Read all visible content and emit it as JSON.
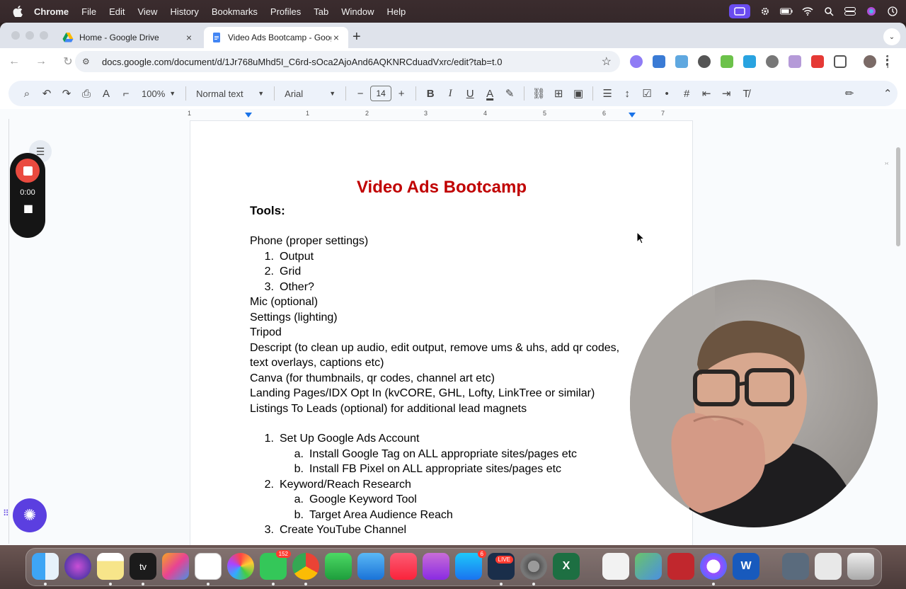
{
  "menubar": {
    "app": "Chrome",
    "items": [
      "File",
      "Edit",
      "View",
      "History",
      "Bookmarks",
      "Profiles",
      "Tab",
      "Window",
      "Help"
    ]
  },
  "tabs": [
    {
      "title": "Home - Google Drive",
      "icon": "google-drive-icon"
    },
    {
      "title": "Video Ads Bootcamp - Googl",
      "icon": "google-docs-icon"
    }
  ],
  "address_bar": {
    "url": "docs.google.com/document/d/1Jr768uMhd5I_C6rd-sOca2AjoAnd6AQKNRCduadVxrc/edit?tab=t.0"
  },
  "toolbar": {
    "zoom": "100%",
    "style": "Normal text",
    "font": "Arial",
    "font_size": "14"
  },
  "ruler": [
    "1",
    "1",
    "2",
    "3",
    "4",
    "5",
    "6",
    "7"
  ],
  "recorder": {
    "time": "0:00"
  },
  "document": {
    "title": "Video Ads Bootcamp",
    "tools_heading": "Tools:",
    "lines": [
      {
        "num": "",
        "text": "Phone (proper settings)"
      },
      {
        "num": "1.",
        "text": "Output"
      },
      {
        "num": "2.",
        "text": "Grid"
      },
      {
        "num": "3.",
        "text": "Other?"
      },
      {
        "num": "",
        "text": "Mic (optional)"
      },
      {
        "num": "",
        "text": "Settings (lighting)"
      },
      {
        "num": "",
        "text": "Tripod"
      },
      {
        "num": "",
        "text": "Descript (to clean up audio, edit output, remove ums & uhs, add qr codes,"
      },
      {
        "num": "",
        "text": "text overlays, captions etc)"
      },
      {
        "num": "",
        "text": "Canva (for thumbnails, qr codes, channel art etc)"
      },
      {
        "num": "",
        "text": "Landing Pages/IDX Opt In (kvCORE, GHL, Lofty, LinkTree or similar)"
      },
      {
        "num": "",
        "text": "Listings To Leads (optional) for additional lead magnets"
      },
      {
        "num": "1.",
        "text": "Set Up Google Ads Account"
      },
      {
        "num": "a.",
        "text": "Install Google Tag on ALL appropriate sites/pages etc"
      },
      {
        "num": "b.",
        "text": "Install FB Pixel on ALL appropriate sites/pages etc"
      },
      {
        "num": "2.",
        "text": "Keyword/Reach Research"
      },
      {
        "num": "a.",
        "text": "Google Keyword Tool"
      },
      {
        "num": "b.",
        "text": "Target Area Audience Reach"
      },
      {
        "num": "3.",
        "text": "Create YouTube Channel"
      }
    ]
  },
  "dock": {
    "badges": {
      "messages": "152",
      "appstore": "6",
      "live": "LIVE"
    }
  },
  "colors": {
    "title_red": "#c00000",
    "record_red": "#ea4a3f",
    "assistant_purple": "#5b3fe0"
  }
}
